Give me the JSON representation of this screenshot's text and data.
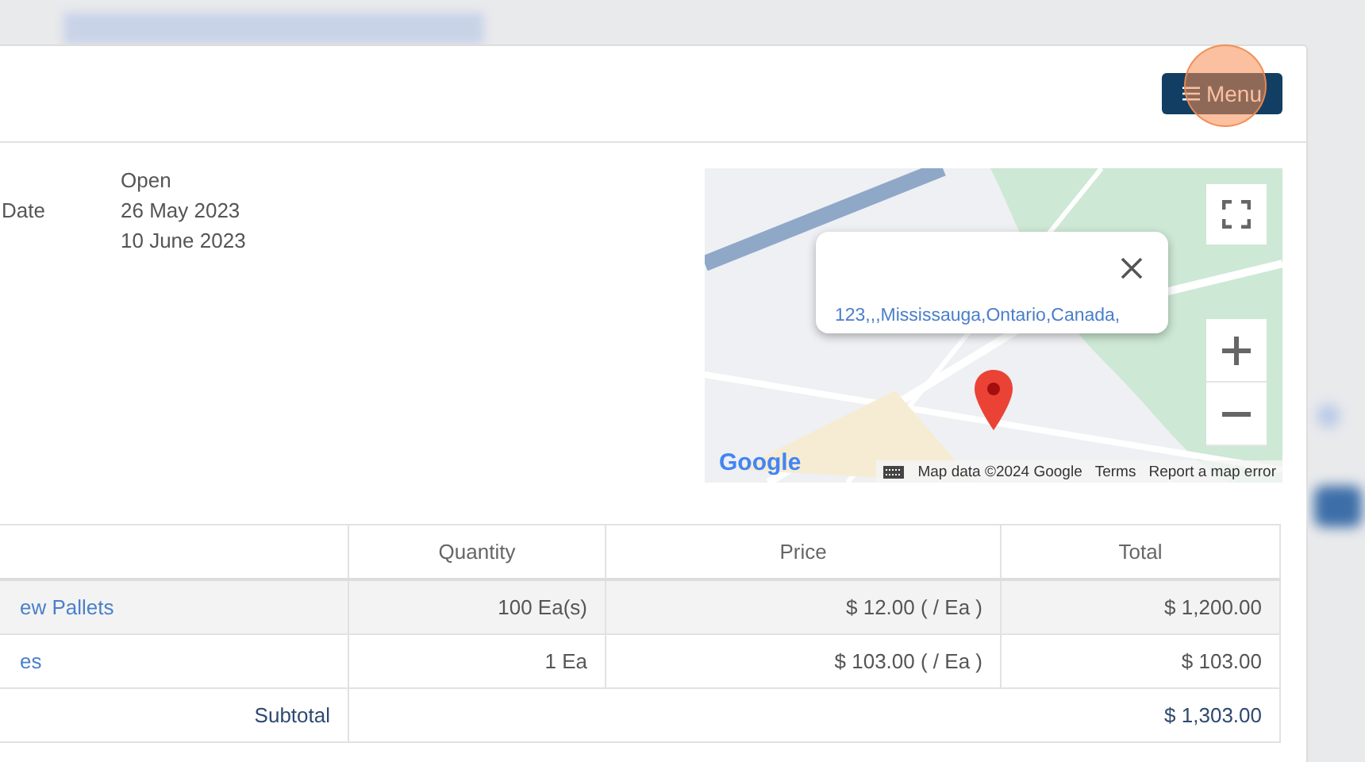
{
  "header": {
    "menu_label": "Menu",
    "highlighted": true
  },
  "details": [
    {
      "value": "Open"
    },
    {
      "label": "Date",
      "value": "26 May 2023"
    },
    {
      "value": "10 June 2023"
    }
  ],
  "map": {
    "popup_address": "123,,,Mississauga,Ontario,Canada,",
    "logo": "Google",
    "attribution": "Map data ©2024 Google",
    "terms": "Terms",
    "report": "Report a map error"
  },
  "table": {
    "columns": [
      "Quantity",
      "Price",
      "Total"
    ],
    "rows": [
      {
        "item": "ew Pallets",
        "quantity": "100 Ea(s)",
        "price": "$ 12.00 ( / Ea )",
        "total": "$ 1,200.00",
        "selected": true
      },
      {
        "item": "es",
        "quantity": "1 Ea",
        "price": "$ 103.00 ( / Ea )",
        "total": "$ 103.00",
        "selected": false
      }
    ],
    "summary": [
      {
        "label": "Subtotal",
        "value": "$ 1,303.00"
      }
    ]
  }
}
